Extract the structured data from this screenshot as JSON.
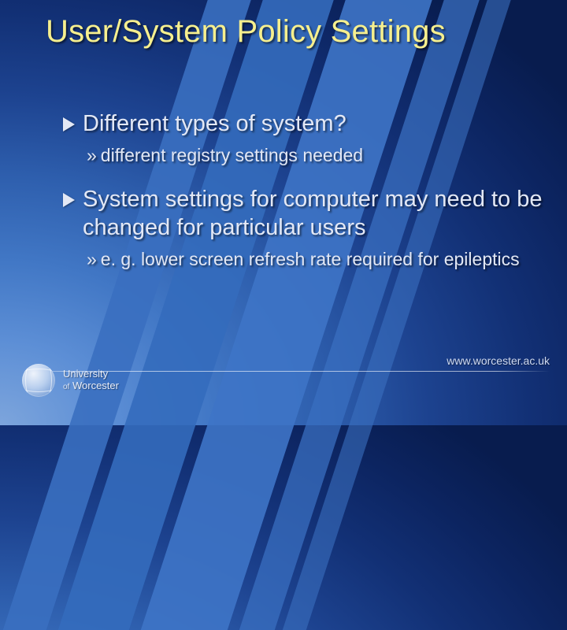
{
  "title": "User/System Policy Settings",
  "points": [
    {
      "text": "Different types of system?",
      "sub": "different registry settings needed"
    },
    {
      "text": "System settings for computer may need to be changed for particular users",
      "sub": "e. g. lower screen refresh rate required for epileptics"
    }
  ],
  "footer": {
    "institution_line1": "University",
    "institution_of": "of",
    "institution_line2": "Worcester",
    "url": "www.worcester.ac.uk"
  },
  "raquo": "»"
}
